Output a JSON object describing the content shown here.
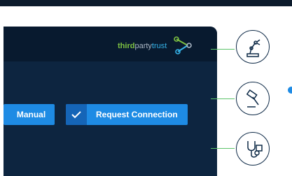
{
  "brand": {
    "part1": "third",
    "part2": "party",
    "part3": "trust",
    "colors": {
      "part1": "#7dc142",
      "part2": "#a9b6c4",
      "part3": "#35b3e8"
    },
    "icon": "chain-link-logo-icon"
  },
  "actions": {
    "manual_label": "Manual",
    "request_label": "Request Connection"
  },
  "categories": [
    {
      "icon": "robotic-arm-icon"
    },
    {
      "icon": "gavel-icon"
    },
    {
      "icon": "stethoscope-icon"
    }
  ],
  "colors": {
    "panel": "#0d2540",
    "header": "#081a2f",
    "button": "#1e8be4",
    "connector": "#5cc36a"
  }
}
